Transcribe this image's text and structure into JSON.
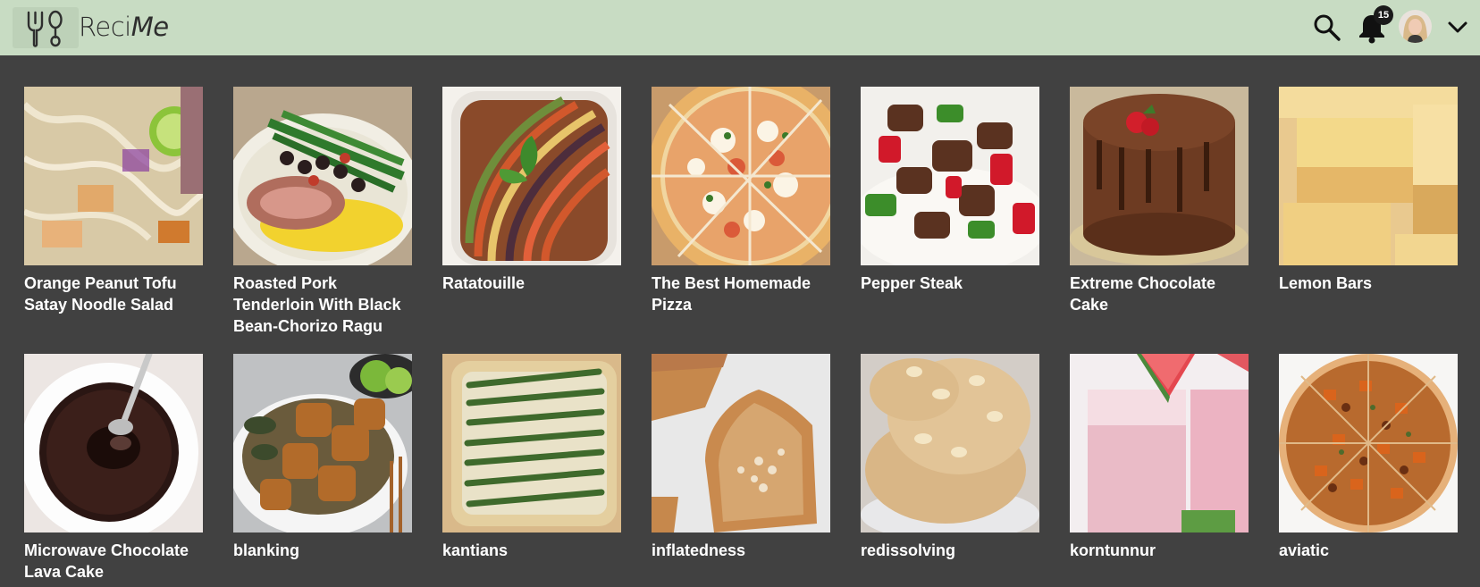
{
  "app": {
    "name_plain": "Reci",
    "name_italic": "Me"
  },
  "header": {
    "notification_count": "15"
  },
  "recipes": [
    {
      "title": "Orange Peanut Tofu Satay Noodle Salad"
    },
    {
      "title": "Roasted Pork Tenderloin With Black Bean-Chorizo Ragu"
    },
    {
      "title": "Ratatouille"
    },
    {
      "title": "The Best Homemade Pizza"
    },
    {
      "title": "Pepper Steak"
    },
    {
      "title": "Extreme Chocolate Cake"
    },
    {
      "title": "Lemon Bars"
    },
    {
      "title": "Microwave Chocolate Lava Cake"
    },
    {
      "title": "blanking"
    },
    {
      "title": "kantians"
    },
    {
      "title": "inflatedness"
    },
    {
      "title": "redissolving"
    },
    {
      "title": "korntunnur"
    },
    {
      "title": "aviatic"
    }
  ],
  "colors": {
    "header_bg": "#c8dcc3",
    "page_bg": "#414141",
    "title_text": "#ffffff"
  }
}
